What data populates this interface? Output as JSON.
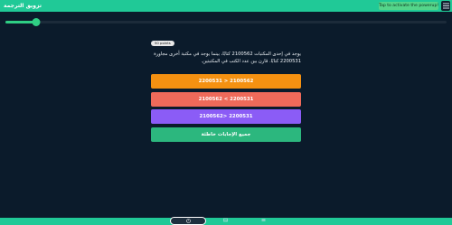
{
  "header": {
    "title": "تزويق الترجمة",
    "powerup_label": "Tap to activate the powerup!"
  },
  "progress": {
    "fraction": 0.07
  },
  "question": {
    "points_label": "50 points",
    "text": "يوجد في إحدى المكتبات 2100562 كتابًا، بينما يوجد في مكتبة أخرى مجاورة 2200531 كتابًا. قارن بين عدد الكتب في المكتبتين."
  },
  "answers": [
    "2100562 < 2200531",
    "2200531 > 2100562",
    "2200531 <2100562",
    "جميع الإجابات خاطئة"
  ],
  "colors": {
    "topbar": "#20c997",
    "background": "#0b1b2b",
    "answer_1": "#f59111",
    "answer_2": "#ef6a5a",
    "answer_3": "#8b5cf6",
    "answer_4": "#2cb77e"
  },
  "icons": {
    "menu": "menu-icon",
    "nav_left": "timer-icon",
    "nav_center": "image-icon",
    "nav_right": "list-icon"
  }
}
